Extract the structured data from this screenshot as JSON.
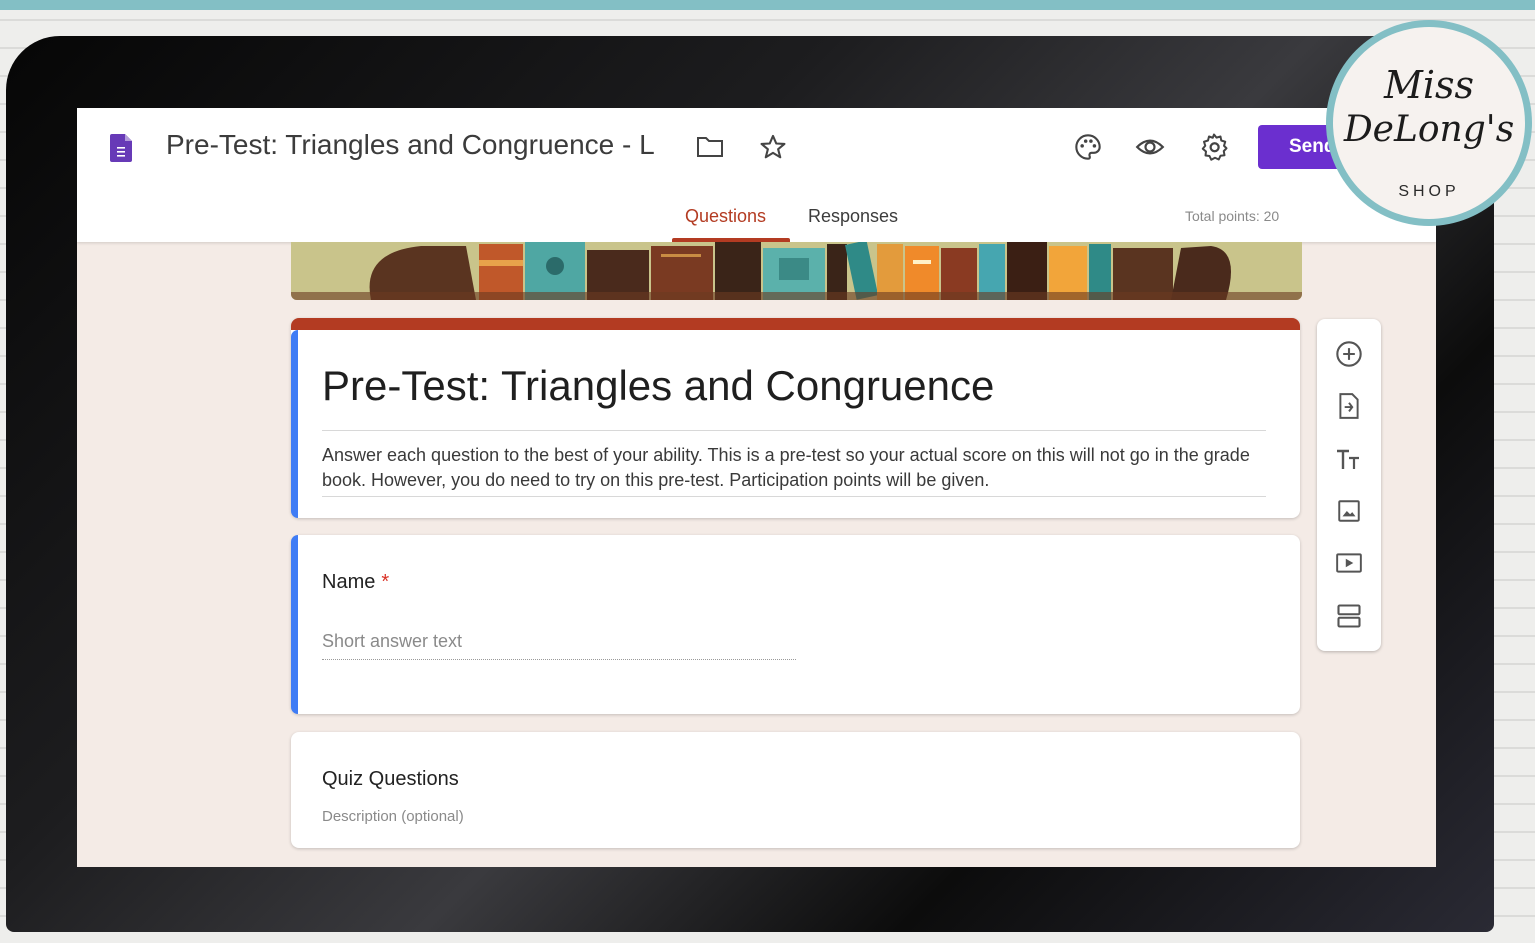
{
  "document": {
    "title": "Pre-Test: Triangles and Congruence - L",
    "send_label": "Send"
  },
  "tabs": [
    {
      "label": "Questions",
      "active": true
    },
    {
      "label": "Responses",
      "active": false
    }
  ],
  "total_points": "Total points: 20",
  "form": {
    "title": "Pre-Test: Triangles and Congruence",
    "description": "Answer each question to the best of your ability. This is a pre-test so your actual score on this will not go in the grade book. However, you do need to try on this pre-test. Participation points will be given."
  },
  "question": {
    "label": "Name",
    "required_mark": "*",
    "placeholder": "Short answer text"
  },
  "section": {
    "title": "Quiz Questions",
    "description": "Description (optional)"
  },
  "toolbar": [
    "add-question-icon",
    "import-questions-icon",
    "add-title-icon",
    "add-image-icon",
    "add-video-icon",
    "add-section-icon"
  ],
  "header_icons": [
    "folder-icon",
    "star-icon",
    "palette-icon",
    "preview-icon",
    "settings-icon"
  ],
  "badge": {
    "line1": "Miss",
    "line2": "DeLong's",
    "line3": "SHOP"
  },
  "colors": {
    "accent": "#b33b22",
    "send": "#6b2fcf",
    "left_accent": "#3f7cf5",
    "frame_teal": "#83bfc5"
  }
}
